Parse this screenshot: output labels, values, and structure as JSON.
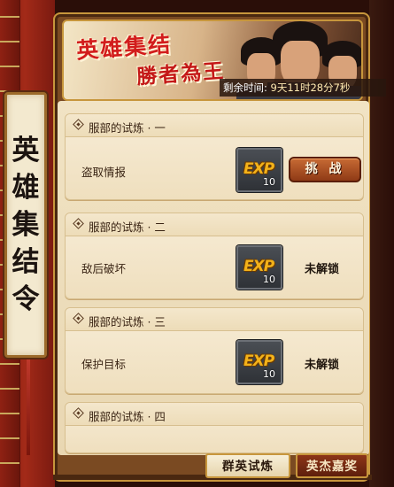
{
  "side_scroll": {
    "chars": [
      "英",
      "雄",
      "集",
      "结",
      "令"
    ]
  },
  "banner": {
    "title_line1": "英雄集结",
    "title_line2": "勝者為王",
    "timer_label": "剩余时间:",
    "timer_value": "9天11时28分7秒"
  },
  "trials": [
    {
      "title": "服部的试炼 · 一",
      "task": "盗取情报",
      "reward_label": "EXP",
      "reward_count": "10",
      "action": "挑 战"
    },
    {
      "title": "服部的试炼 · 二",
      "task": "敌后破坏",
      "reward_label": "EXP",
      "reward_count": "10",
      "status": "未解锁"
    },
    {
      "title": "服部的试炼 · 三",
      "task": "保护目标",
      "reward_label": "EXP",
      "reward_count": "10",
      "status": "未解锁"
    },
    {
      "title": "服部的试炼 · 四"
    }
  ],
  "tabs": [
    {
      "label": "群英试炼",
      "active": true
    },
    {
      "label": "英杰嘉奖",
      "active": false
    }
  ],
  "colors": {
    "banner_title": "#d21c1c",
    "exp_gold": "#f3b21a",
    "pillar_red": "#a32a18",
    "parchment": "#f1e3c4"
  }
}
